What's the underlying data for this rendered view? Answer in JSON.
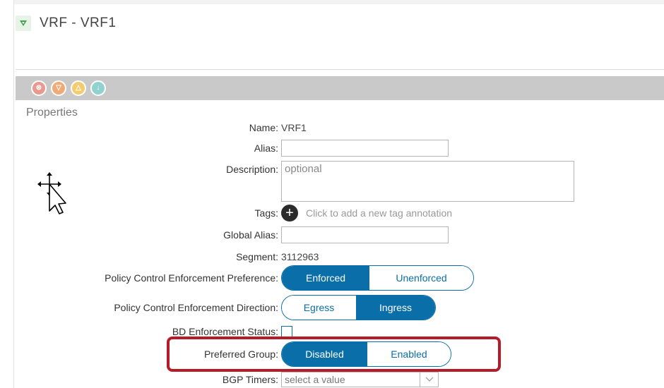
{
  "header": {
    "title": "VRF - VRF1"
  },
  "faults": {
    "critical": "⊗",
    "major": "▽",
    "minor": "△",
    "warning": "↓"
  },
  "section": {
    "title": "Properties"
  },
  "fields": {
    "name": {
      "label": "Name:",
      "value": "VRF1"
    },
    "alias": {
      "label": "Alias:",
      "value": ""
    },
    "description": {
      "label": "Description:",
      "placeholder": "optional"
    },
    "tags": {
      "label": "Tags:",
      "hint": "Click to add a new tag annotation"
    },
    "global_alias": {
      "label": "Global Alias:",
      "value": ""
    },
    "segment": {
      "label": "Segment:",
      "value": "3112963"
    },
    "pc_pref": {
      "label": "Policy Control Enforcement Preference:",
      "options": [
        "Enforced",
        "Unenforced"
      ],
      "selected": "Enforced"
    },
    "pc_dir": {
      "label": "Policy Control Enforcement Direction:",
      "options": [
        "Egress",
        "Ingress"
      ],
      "selected": "Ingress"
    },
    "bd_status": {
      "label": "BD Enforcement Status:",
      "checked": false
    },
    "preferred_group": {
      "label": "Preferred Group:",
      "options": [
        "Disabled",
        "Enabled"
      ],
      "selected": "Disabled"
    },
    "bgp_timers": {
      "label": "BGP Timers:",
      "placeholder": "select a value"
    }
  },
  "colors": {
    "accent": "#0a6ea8",
    "highlight": "#b51b28",
    "fault_bar": "#c9c9c9"
  }
}
